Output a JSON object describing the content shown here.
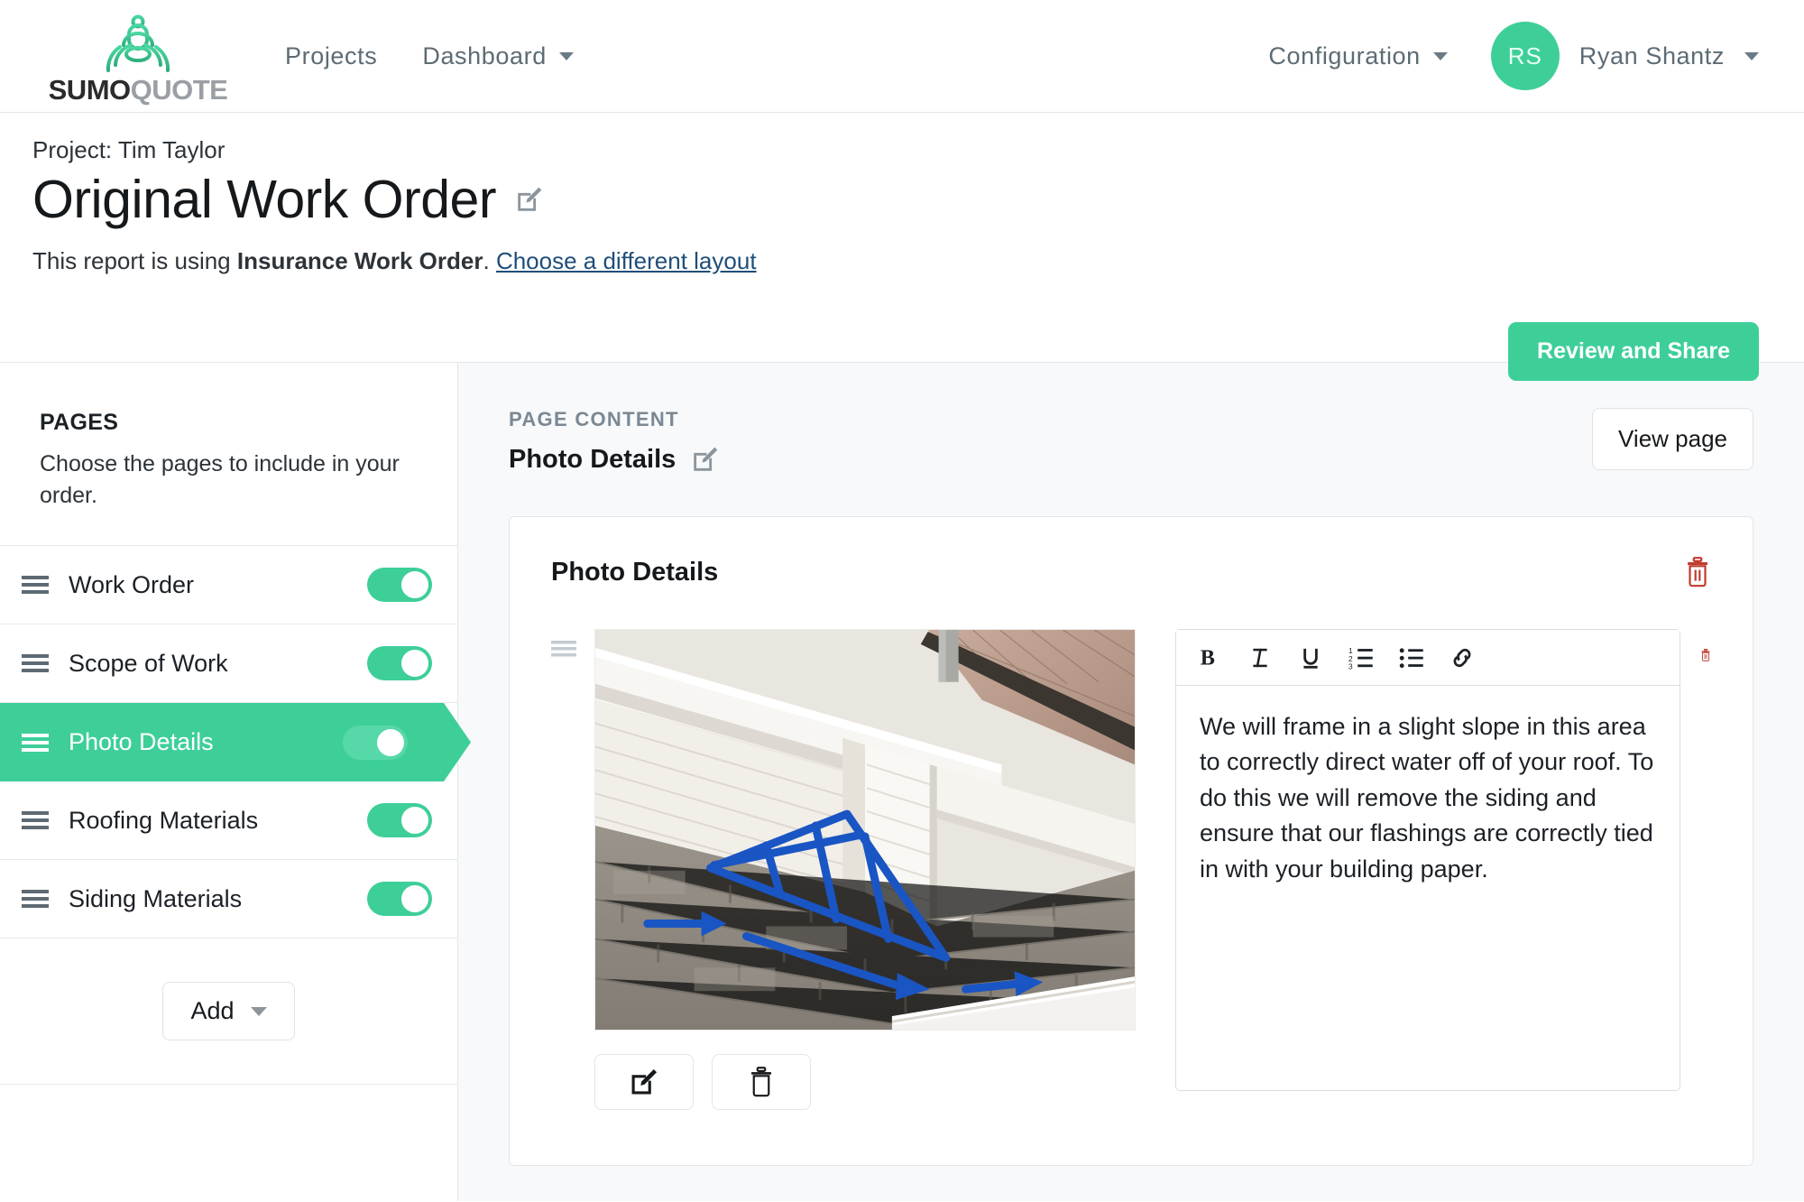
{
  "nav": {
    "logo_text_bold": "SUMO",
    "logo_text_light": "QUOTE",
    "logo_icon": "sumo-wrestler-logo",
    "links": [
      {
        "label": "Projects",
        "has_caret": false
      },
      {
        "label": "Dashboard",
        "has_caret": true
      }
    ],
    "configuration_label": "Configuration",
    "user": {
      "initials": "RS",
      "name": "Ryan Shantz"
    }
  },
  "header": {
    "breadcrumb": "Project: Tim Taylor",
    "title": "Original Work Order",
    "edit_icon": "edit-square-icon",
    "layout_note_prefix": "This report is using ",
    "layout_name": "Insurance Work Order",
    "layout_note_suffix": ". ",
    "layout_link": "Choose a different layout",
    "review_button": "Review and Share"
  },
  "sidebar": {
    "heading": "PAGES",
    "description": "Choose the pages to include in your order.",
    "items": [
      {
        "label": "Work Order",
        "enabled": true,
        "active": false
      },
      {
        "label": "Scope of Work",
        "enabled": true,
        "active": false
      },
      {
        "label": "Photo Details",
        "enabled": true,
        "active": true
      },
      {
        "label": "Roofing Materials",
        "enabled": true,
        "active": false
      },
      {
        "label": "Siding Materials",
        "enabled": true,
        "active": false
      }
    ],
    "add_button": "Add"
  },
  "content": {
    "kicker": "PAGE CONTENT",
    "title": "Photo Details",
    "title_edit_icon": "edit-square-icon",
    "view_page_button": "View page",
    "card": {
      "title": "Photo Details",
      "delete_icon": "trash-icon",
      "photo": {
        "alt": "roof-photo-with-blue-markup",
        "edit_icon": "edit-square-icon",
        "delete_icon": "trash-icon"
      },
      "editor": {
        "toolbar": [
          {
            "name": "bold",
            "glyph": "B"
          },
          {
            "name": "italic",
            "glyph": "I"
          },
          {
            "name": "underline",
            "glyph": "U"
          },
          {
            "name": "ordered-list",
            "glyph": "1."
          },
          {
            "name": "unordered-list",
            "glyph": "•"
          },
          {
            "name": "link",
            "glyph": "🔗"
          }
        ],
        "text": "We will frame in a slight slope in this area to correctly direct water off of your roof. To do this we will remove the siding and ensure that our flashings are correctly tied in with your building paper.",
        "delete_icon": "trash-icon"
      }
    }
  },
  "colors": {
    "brand_green": "#3ecf99",
    "link_blue": "#1f4e79",
    "danger_red": "#c0392b",
    "text_dark": "#16191c",
    "muted": "#7b8894",
    "page_bg": "#f7f9fa"
  }
}
